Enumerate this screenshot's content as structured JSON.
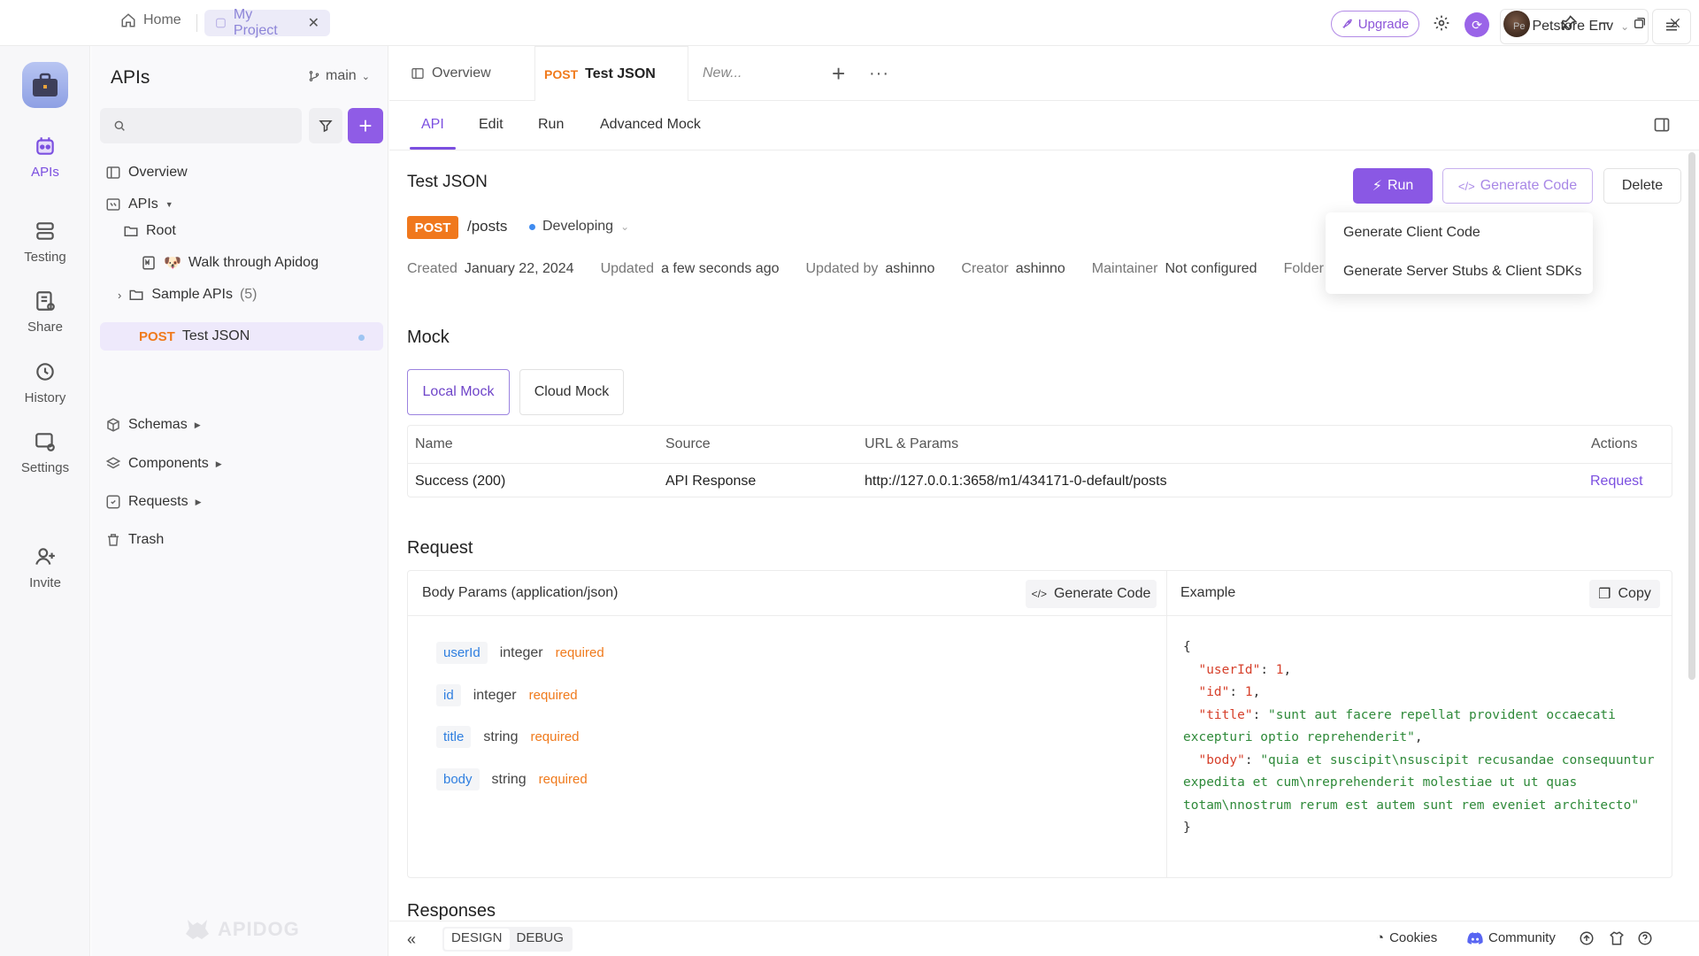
{
  "titlebar": {
    "home_label": "Home",
    "project_label": "My Project",
    "upgrade_label": "Upgrade"
  },
  "rail": {
    "items": [
      {
        "label": "APIs",
        "icon": "apis-icon"
      },
      {
        "label": "Testing",
        "icon": "testing-icon"
      },
      {
        "label": "Share",
        "icon": "share-icon"
      },
      {
        "label": "History",
        "icon": "history-icon"
      },
      {
        "label": "Settings",
        "icon": "settings-icon"
      },
      {
        "label": "Invite",
        "icon": "invite-icon"
      }
    ]
  },
  "sidebar": {
    "title": "APIs",
    "branch": "main",
    "search_placeholder": "",
    "tree": {
      "overview": "Overview",
      "apis": "APIs",
      "root": "Root",
      "walkthrough": "Walk through Apidog",
      "sample_apis": "Sample APIs",
      "sample_count": "(5)",
      "selected_method": "POST",
      "selected_name": "Test JSON",
      "schemas": "Schemas",
      "components": "Components",
      "requests": "Requests",
      "trash": "Trash"
    },
    "watermark": "APIDOG"
  },
  "tabs": {
    "overview": "Overview",
    "active_method": "POST",
    "active_name": "Test JSON",
    "new_tab": "New...",
    "env_abbr": "Pe",
    "env_name": "Petstore Env"
  },
  "subtabs": [
    "API",
    "Edit",
    "Run",
    "Advanced Mock"
  ],
  "api": {
    "title": "Test JSON",
    "run_label": "Run",
    "generate_code_label": "Generate Code",
    "delete_label": "Delete",
    "method": "POST",
    "path": "/posts",
    "status": "Developing",
    "meta": {
      "created_k": "Created",
      "created_v": "January 22, 2024",
      "updated_k": "Updated",
      "updated_v": "a few seconds ago",
      "updated_by_k": "Updated by",
      "updated_by_v": "ashinno",
      "creator_k": "Creator",
      "creator_v": "ashinno",
      "maintainer_k": "Maintainer",
      "maintainer_v": "Not configured",
      "folder_k": "Folder"
    }
  },
  "dropdown": {
    "item1": "Generate Client Code",
    "item2": "Generate Server Stubs & Client SDKs"
  },
  "mock": {
    "heading": "Mock",
    "local_tab": "Local Mock",
    "cloud_tab": "Cloud Mock",
    "columns": [
      "Name",
      "Source",
      "URL & Params",
      "Actions"
    ],
    "row": {
      "name": "Success (200)",
      "source": "API Response",
      "url": "http://127.0.0.1:3658/m1/434171-0-default/posts",
      "action": "Request"
    }
  },
  "request": {
    "heading": "Request",
    "body_title": "Body Params (application/json)",
    "generate_code_label": "Generate Code",
    "example_title": "Example",
    "copy_label": "Copy",
    "params": [
      {
        "name": "userId",
        "type": "integer",
        "req": "required"
      },
      {
        "name": "id",
        "type": "integer",
        "req": "required"
      },
      {
        "name": "title",
        "type": "string",
        "req": "required"
      },
      {
        "name": "body",
        "type": "string",
        "req": "required"
      }
    ],
    "example": {
      "open": "{",
      "k1": "\"userId\"",
      "v1": "1",
      "k2": "\"id\"",
      "v2": "1",
      "k3": "\"title\"",
      "v3": "\"sunt aut facere repellat provident occaecati excepturi optio reprehenderit\"",
      "k4": "\"body\"",
      "v4": "\"quia et suscipit\\nsuscipit recusandae consequuntur expedita et cum\\nreprehenderit molestiae ut ut quas totam\\nnostrum rerum est autem sunt rem eveniet architecto\"",
      "close": "}"
    }
  },
  "responses_heading": "Responses",
  "footer": {
    "design": "DESIGN",
    "debug": "DEBUG",
    "cookies": "Cookies",
    "community": "Community"
  },
  "colors": {
    "accent": "#7b4fe0",
    "post": "#f0781d",
    "required": "#f07a1c",
    "param_name": "#2f7fe0"
  }
}
